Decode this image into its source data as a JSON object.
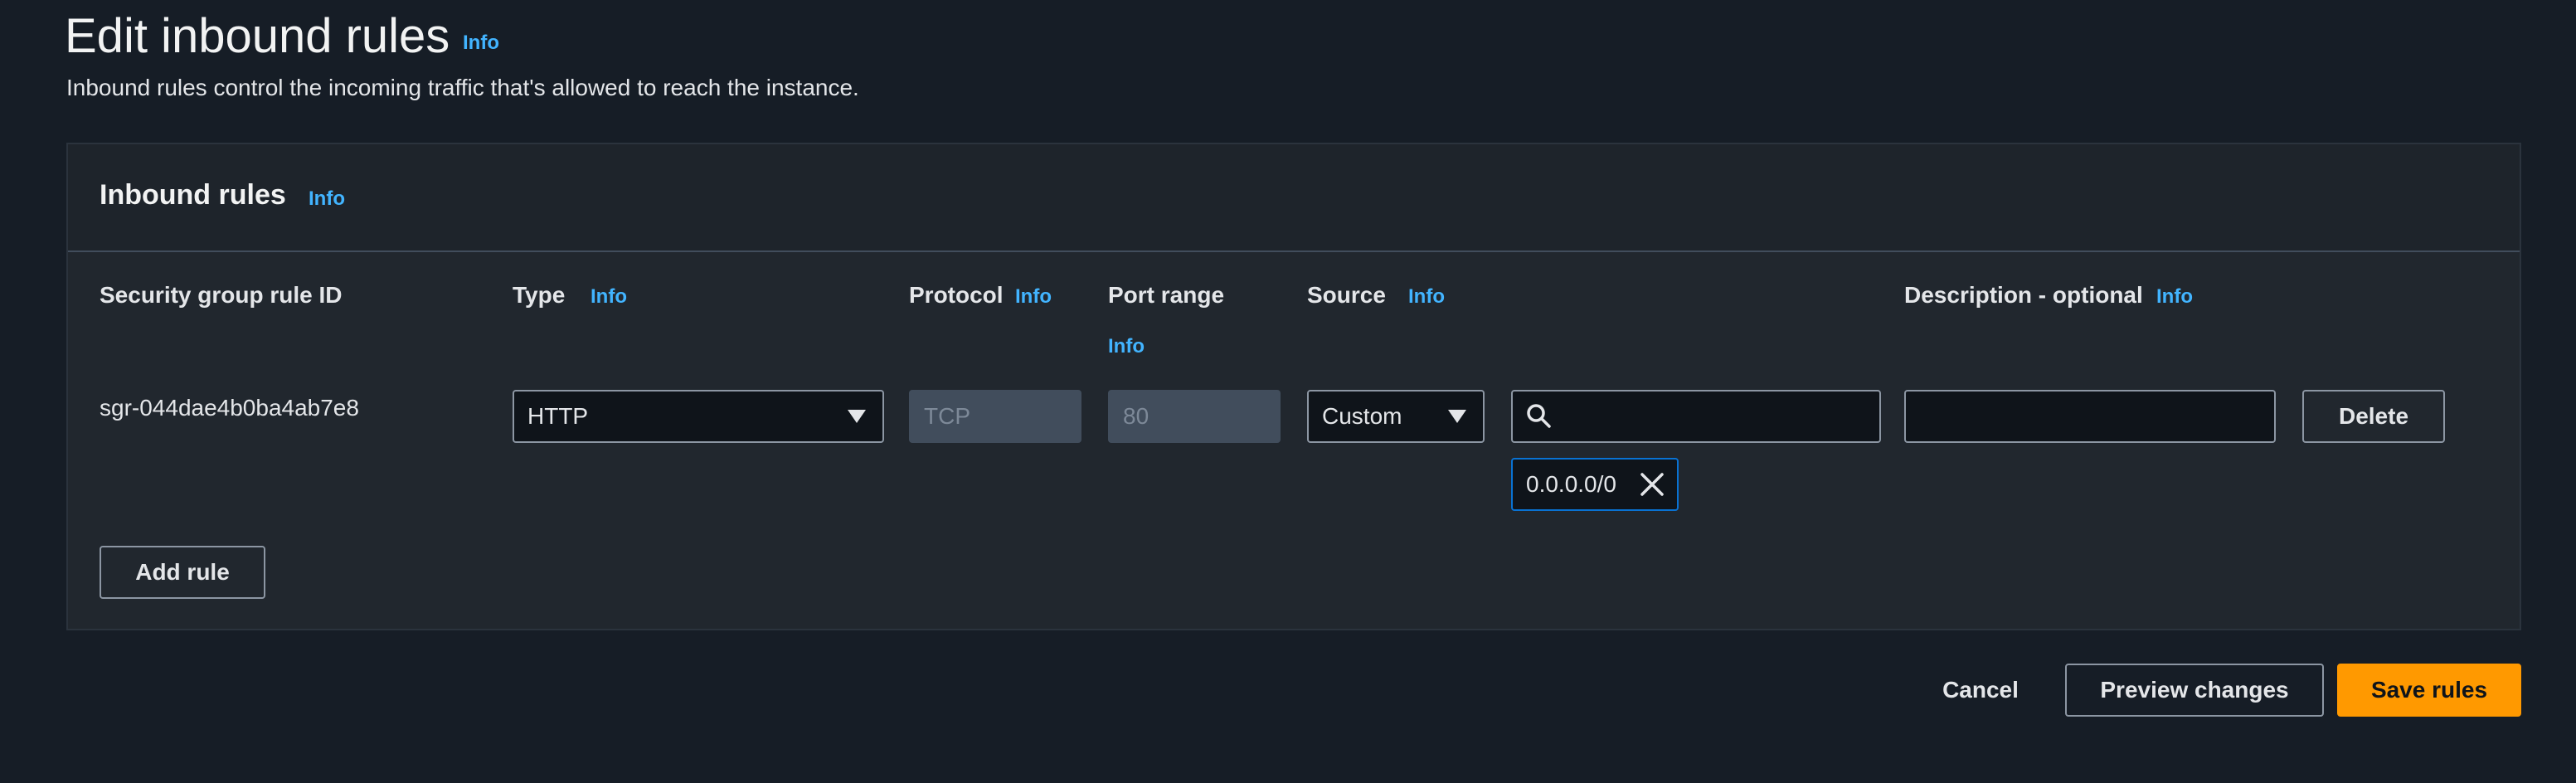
{
  "page": {
    "title": "Edit inbound rules",
    "title_info": "Info",
    "description": "Inbound rules control the incoming traffic that's allowed to reach the instance."
  },
  "panel": {
    "title": "Inbound rules",
    "title_info": "Info",
    "columns": {
      "rule_id": "Security group rule ID",
      "type": "Type",
      "type_info": "Info",
      "protocol": "Protocol",
      "protocol_info": "Info",
      "port_range": "Port range",
      "port_range_info": "Info",
      "source": "Source",
      "source_info": "Info",
      "description": "Description - optional",
      "description_info": "Info"
    },
    "rule": {
      "id": "sgr-044dae4b0ba4ab7e8",
      "type": "HTTP",
      "protocol": "TCP",
      "port_range": "80",
      "source_type": "Custom",
      "source_search_value": "",
      "source_token": "0.0.0.0/0",
      "description_value": "",
      "delete_label": "Delete"
    },
    "add_rule_label": "Add rule"
  },
  "footer": {
    "cancel_label": "Cancel",
    "preview_label": "Preview changes",
    "save_label": "Save rules"
  },
  "colors": {
    "background": "#161d26",
    "panel": "#21272e",
    "info_link": "#42b4ff",
    "primary": "#ff9900",
    "token_border": "#0972d3"
  }
}
